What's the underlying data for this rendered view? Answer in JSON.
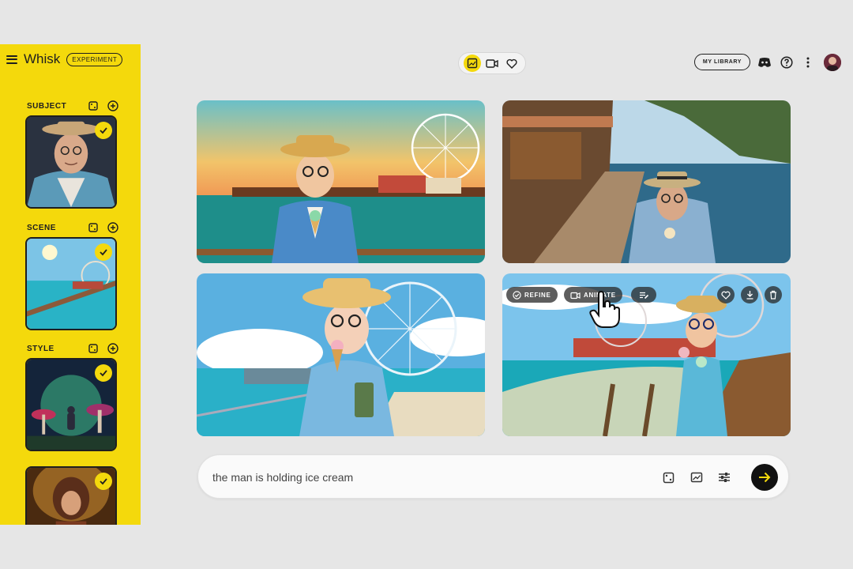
{
  "app": {
    "name": "Whisk",
    "badge": "EXPERIMENT"
  },
  "sidebar": {
    "sections": [
      {
        "title": "SUBJECT",
        "image": "elderly man with glasses in blue jacket",
        "selected": true
      },
      {
        "title": "SCENE",
        "image": "pier with ferris wheel over ocean",
        "selected": true
      },
      {
        "title": "STYLE",
        "image": "glowing mushroom forest with robot",
        "selected": true
      },
      {
        "title": "",
        "image": "singer with microphone on stage",
        "selected": true
      }
    ]
  },
  "topbar": {
    "modes": [
      {
        "icon": "image-edit-icon",
        "active": true
      },
      {
        "icon": "video-camera-icon",
        "active": false
      },
      {
        "icon": "heart-icon",
        "active": false
      }
    ],
    "library_label": "MY LIBRARY",
    "icons": [
      "discord-icon",
      "help-icon",
      "more-vert-icon",
      "avatar"
    ]
  },
  "gallery": {
    "tiles": [
      {
        "description": "cartoon man with ice cream on pier at sunset"
      },
      {
        "description": "realistic man eating ice cream on boardwalk"
      },
      {
        "description": "anime man holding ice cream by ferris wheel"
      },
      {
        "description": "3D render man with ice cream at beach pier"
      }
    ],
    "hover_actions": {
      "refine_label": "REFINE",
      "animate_label": "ANIMATE"
    }
  },
  "prompt": {
    "value": "the man is holding ice cream",
    "placeholder": ""
  },
  "colors": {
    "accent": "#f4d90c",
    "background": "#e6e6e6",
    "dark": "#111111"
  }
}
